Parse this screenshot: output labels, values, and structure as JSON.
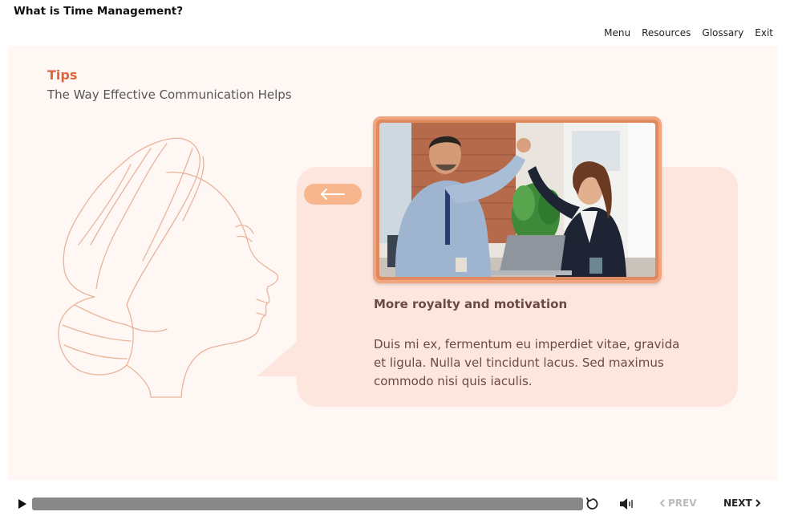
{
  "header": {
    "course_title": "What is Time Management?",
    "nav": [
      "Menu",
      "Resources",
      "Glossary",
      "Exit"
    ]
  },
  "slide": {
    "section_label": "Tips",
    "subtitle": "The Way Effective Communication Helps",
    "card": {
      "title": "More royalty and motivation",
      "body": "Duis mi ex, fermentum eu imperdiet vitae, gravida et ligula. Nulla vel tincidunt lacus. Sed maximus commodo nisi quis iaculis."
    },
    "icons": {
      "back": "left-arrow-icon"
    }
  },
  "player": {
    "prev_label": "PREV",
    "next_label": "NEXT"
  },
  "colors": {
    "accent": "#e0653b",
    "slide_bg": "#fff7f4",
    "bubble_bg": "#fde6dd",
    "frame": "#f3a57f",
    "arrow_btn": "#f8b68e",
    "line_art": "#e8b49c"
  }
}
